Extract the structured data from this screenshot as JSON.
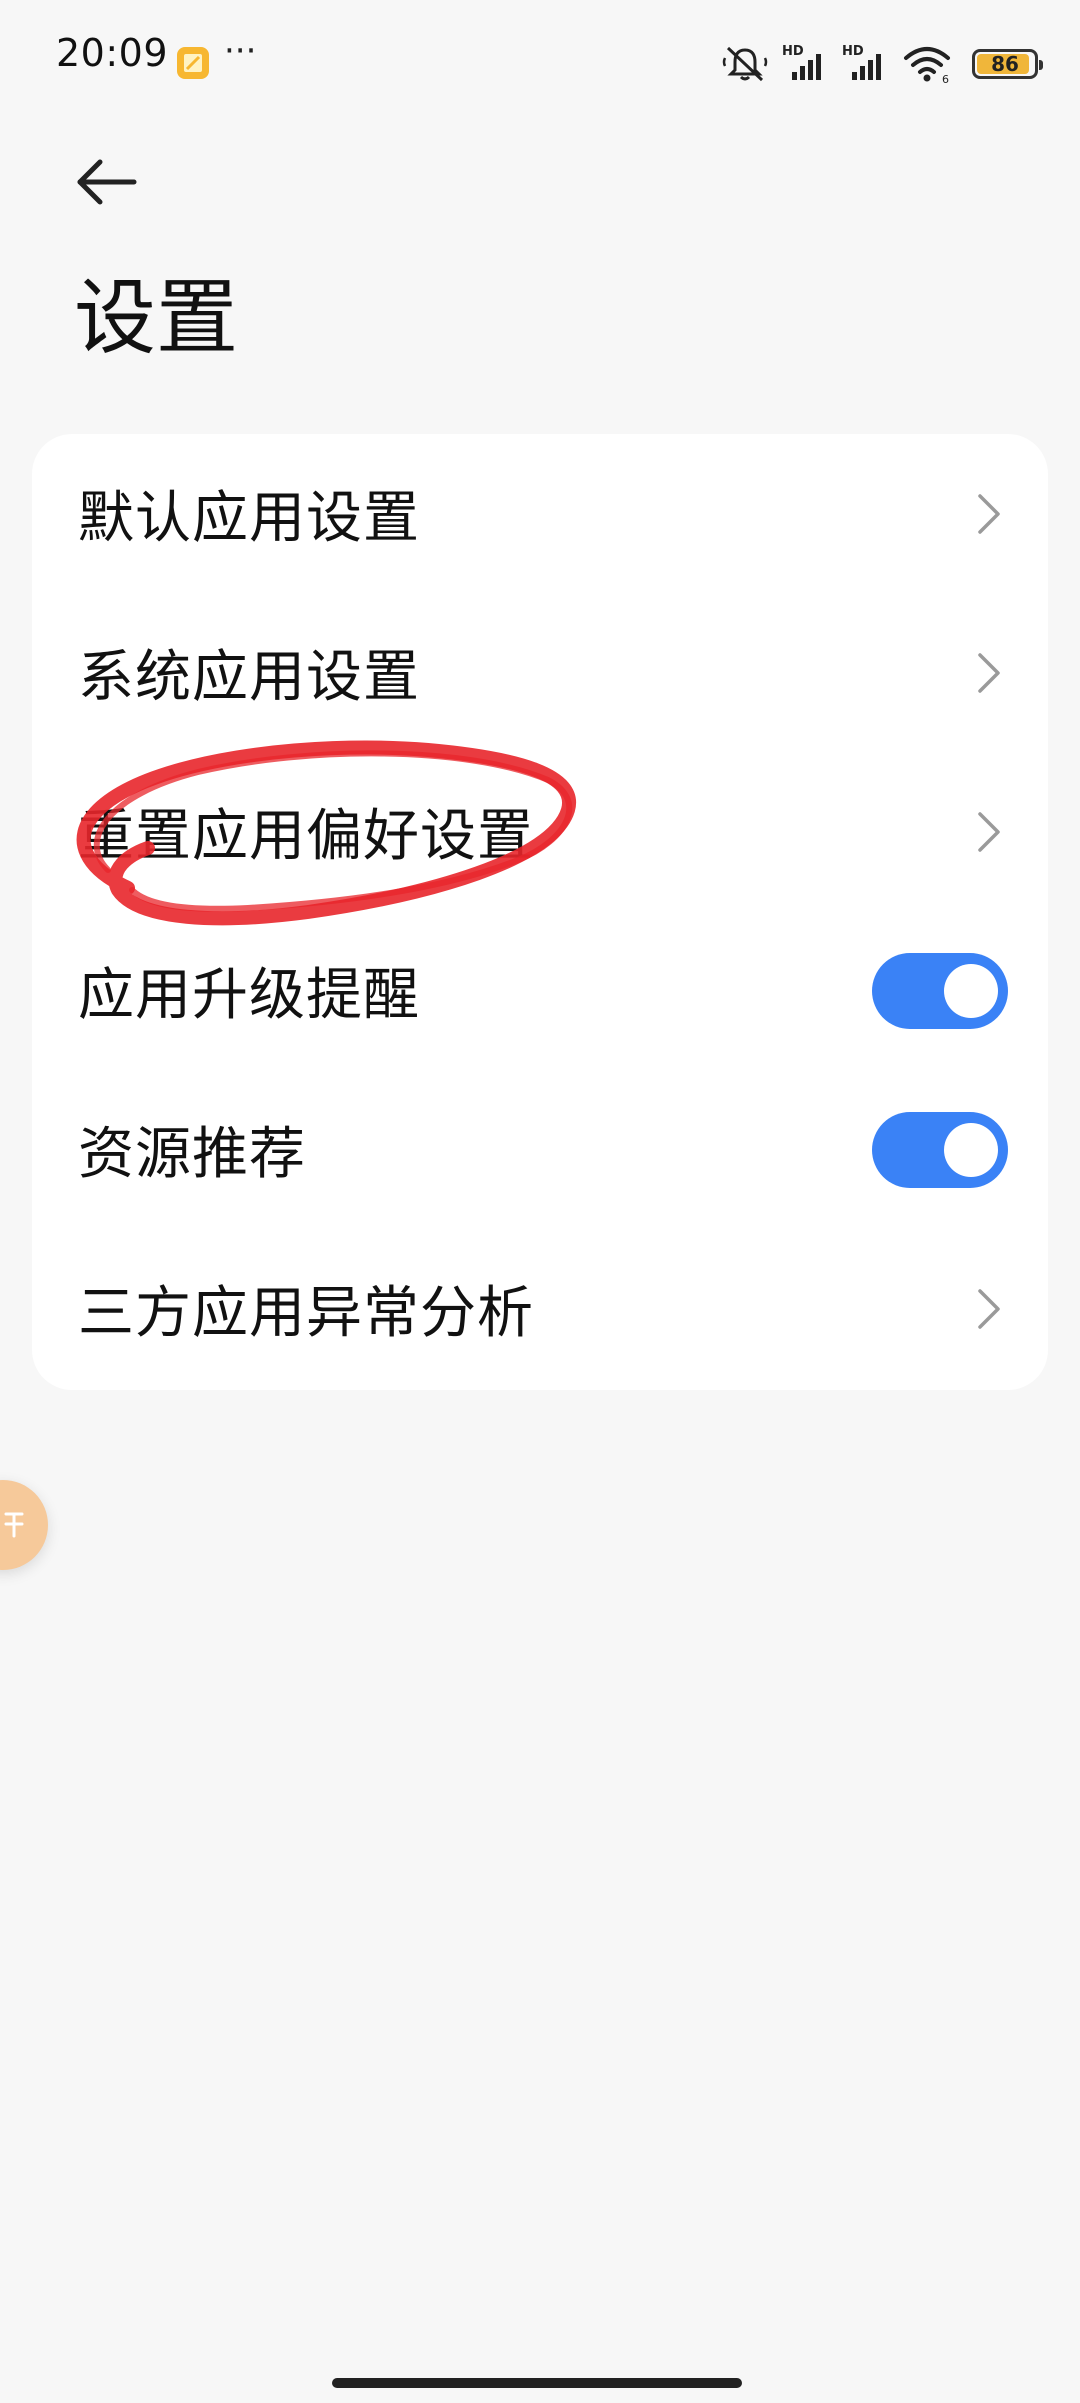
{
  "status_bar": {
    "time": "20:09",
    "more": "···",
    "battery": "86",
    "network_badges": [
      "HD",
      "HD"
    ],
    "icons": [
      "notification-app-icon",
      "mute-icon",
      "signal-icon",
      "signal-icon",
      "wifi-icon",
      "battery-icon"
    ]
  },
  "header": {
    "back_icon": "arrow-left-icon",
    "title": "设置"
  },
  "settings": {
    "items": [
      {
        "label": "默认应用设置",
        "control": "chevron"
      },
      {
        "label": "系统应用设置",
        "control": "chevron"
      },
      {
        "label": "重置应用偏好设置",
        "control": "chevron"
      },
      {
        "label": "应用升级提醒",
        "control": "toggle",
        "on": true
      },
      {
        "label": "资源推荐",
        "control": "toggle",
        "on": true
      },
      {
        "label": "三方应用异常分析",
        "control": "chevron"
      }
    ]
  },
  "colors": {
    "background": "#f7f7f7",
    "card": "#ffffff",
    "toggle_on": "#3a82f6",
    "annotation": "#e8262b",
    "bubble": "#f6c99a"
  }
}
